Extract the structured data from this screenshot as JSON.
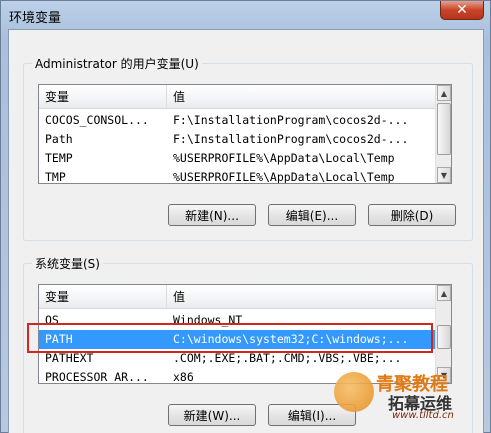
{
  "window": {
    "title": "环境变量",
    "close_glyph": "✕"
  },
  "user_vars": {
    "group_label": "Administrator 的用户变量(U)",
    "columns": [
      "变量",
      "值"
    ],
    "rows": [
      {
        "name": "COCOS_CONSOL...",
        "value": "F:\\InstallationProgram\\cocos2d-..."
      },
      {
        "name": "Path",
        "value": "F:\\InstallationProgram\\cocos2d-..."
      },
      {
        "name": "TEMP",
        "value": "%USERPROFILE%\\AppData\\Local\\Temp"
      },
      {
        "name": "TMP",
        "value": "%USERPROFILE%\\AppData\\Local\\Temp"
      }
    ],
    "buttons": {
      "new": "新建(N)...",
      "edit": "编辑(E)...",
      "delete": "删除(D)"
    }
  },
  "system_vars": {
    "group_label": "系统变量(S)",
    "columns": [
      "变量",
      "值"
    ],
    "rows": [
      {
        "name": "OS",
        "value": "Windows_NT"
      },
      {
        "name": "PATH",
        "value": "C:\\windows\\system32;C:\\windows;..."
      },
      {
        "name": "PATHEXT",
        "value": ".COM;.EXE;.BAT;.CMD;.VBS;.VBE;..."
      },
      {
        "name": "PROCESSOR_AR...",
        "value": "x86"
      }
    ],
    "selected_row": 1,
    "buttons": {
      "new": "新建(W)...",
      "edit": "编辑(I)..."
    }
  },
  "watermark": {
    "line1": "青聚教程",
    "line2": "拓幕运维",
    "url": "www.tlltd.cn"
  },
  "colors": {
    "selection": "#3399ff",
    "highlight_box": "#d0281e"
  }
}
